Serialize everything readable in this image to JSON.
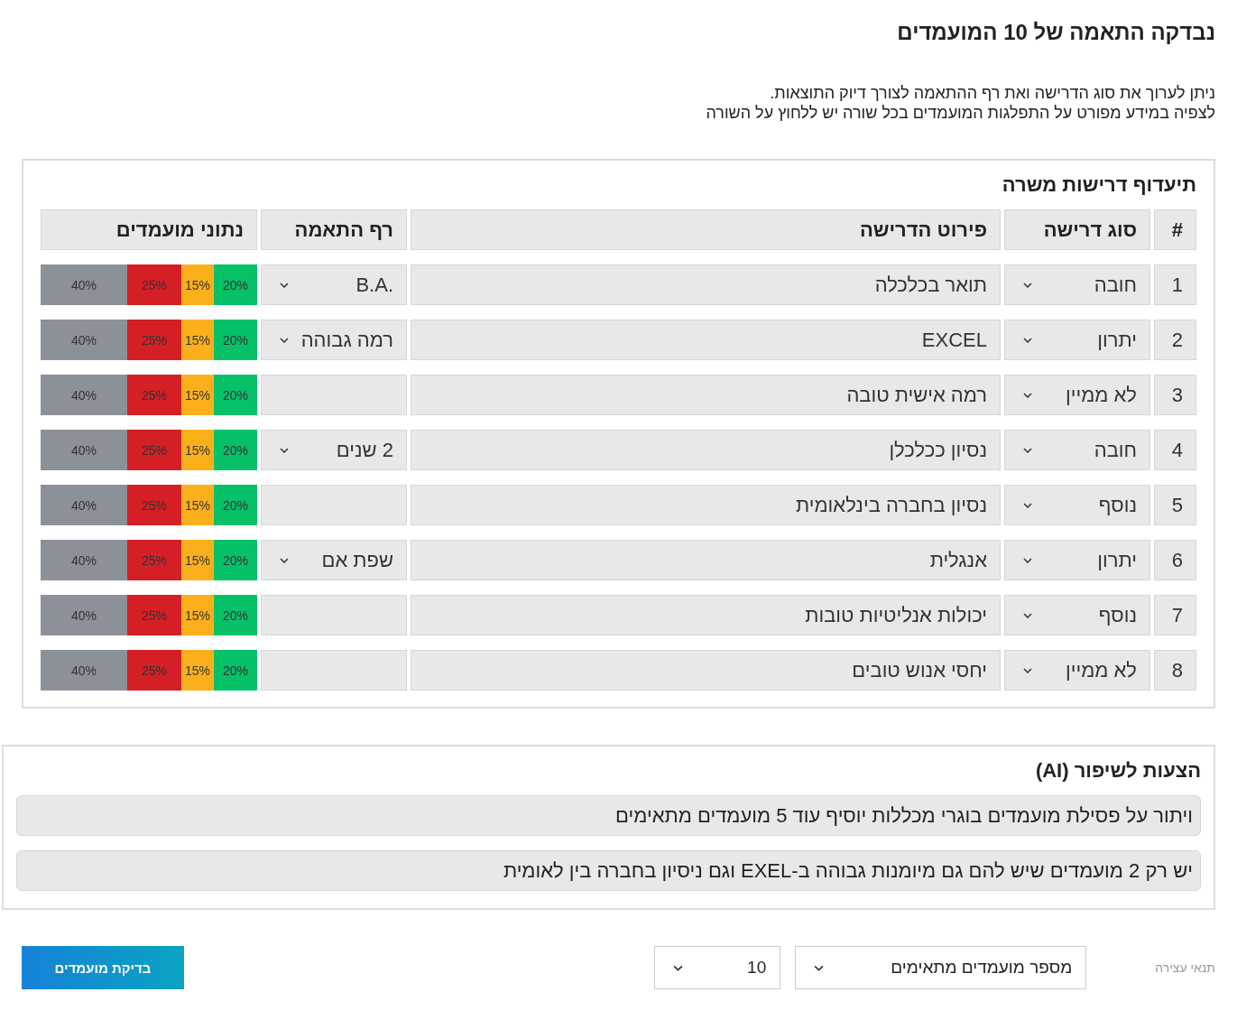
{
  "title": "נבדקה התאמה של 10 המועמדים",
  "intro": [
    "ניתן לערוך את סוג הדרישה ואת רף ההתאמה לצורך דיוק התוצאות.",
    "לצפיה במידע מפורט על התפלגות המועמדים בכל שורה יש ללחוץ על השורה"
  ],
  "requirements": {
    "title": "תיעדוף דרישות משרה",
    "columns": [
      "#",
      "סוג דרישה",
      "פירוט הדרישה",
      "רף התאמה",
      "נתוני מועמדים"
    ],
    "rows": [
      {
        "number": "1",
        "type": "חובה",
        "detail": "תואר בכלכלה",
        "threshold": "B.A.",
        "chart_data": {
          "type": "bar",
          "orientation": "horizontal",
          "stacked": true,
          "series": [
            {
              "color": "#8c9199",
              "values": [
                40
              ],
              "value_labels": [
                "40%"
              ]
            },
            {
              "color": "#d41f26",
              "values": [
                25
              ],
              "value_labels": [
                "25%"
              ]
            },
            {
              "color": "#fbb01b",
              "values": [
                15
              ],
              "value_labels": [
                "15%"
              ]
            },
            {
              "color": "#06c167",
              "values": [
                20
              ],
              "value_labels": [
                "20%"
              ]
            }
          ]
        }
      },
      {
        "number": "2",
        "type": "יתרון",
        "detail": "EXCEL",
        "threshold": "רמה גבוהה",
        "chart_data": {
          "type": "bar",
          "orientation": "horizontal",
          "stacked": true,
          "series": [
            {
              "color": "#8c9199",
              "values": [
                40
              ],
              "value_labels": [
                "40%"
              ]
            },
            {
              "color": "#d41f26",
              "values": [
                25
              ],
              "value_labels": [
                "25%"
              ]
            },
            {
              "color": "#fbb01b",
              "values": [
                15
              ],
              "value_labels": [
                "15%"
              ]
            },
            {
              "color": "#06c167",
              "values": [
                20
              ],
              "value_labels": [
                "20%"
              ]
            }
          ]
        }
      },
      {
        "number": "3",
        "type": "לא ממיין",
        "detail": "רמה אישית טובה",
        "chart_data": {
          "type": "bar",
          "orientation": "horizontal",
          "stacked": true,
          "series": [
            {
              "color": "#8c9199",
              "values": [
                40
              ],
              "value_labels": [
                "40%"
              ]
            },
            {
              "color": "#d41f26",
              "values": [
                25
              ],
              "value_labels": [
                "25%"
              ]
            },
            {
              "color": "#fbb01b",
              "values": [
                15
              ],
              "value_labels": [
                "15%"
              ]
            },
            {
              "color": "#06c167",
              "values": [
                20
              ],
              "value_labels": [
                "20%"
              ]
            }
          ]
        }
      },
      {
        "number": "4",
        "type": "חובה",
        "detail": "נסיון ככלכלן",
        "threshold": "2 שנים",
        "chart_data": {
          "type": "bar",
          "orientation": "horizontal",
          "stacked": true,
          "series": [
            {
              "color": "#8c9199",
              "values": [
                40
              ],
              "value_labels": [
                "40%"
              ]
            },
            {
              "color": "#d41f26",
              "values": [
                25
              ],
              "value_labels": [
                "25%"
              ]
            },
            {
              "color": "#fbb01b",
              "values": [
                15
              ],
              "value_labels": [
                "15%"
              ]
            },
            {
              "color": "#06c167",
              "values": [
                20
              ],
              "value_labels": [
                "20%"
              ]
            }
          ]
        }
      },
      {
        "number": "5",
        "type": "נוסף",
        "detail": "נסיון בחברה בינלאומית",
        "chart_data": {
          "type": "bar",
          "orientation": "horizontal",
          "stacked": true,
          "series": [
            {
              "color": "#8c9199",
              "values": [
                40
              ],
              "value_labels": [
                "40%"
              ]
            },
            {
              "color": "#d41f26",
              "values": [
                25
              ],
              "value_labels": [
                "25%"
              ]
            },
            {
              "color": "#fbb01b",
              "values": [
                15
              ],
              "value_labels": [
                "15%"
              ]
            },
            {
              "color": "#06c167",
              "values": [
                20
              ],
              "value_labels": [
                "20%"
              ]
            }
          ]
        }
      },
      {
        "number": "6",
        "type": "יתרון",
        "detail": "אנגלית",
        "threshold": "שפת אם",
        "chart_data": {
          "type": "bar",
          "orientation": "horizontal",
          "stacked": true,
          "series": [
            {
              "color": "#8c9199",
              "values": [
                40
              ],
              "value_labels": [
                "40%"
              ]
            },
            {
              "color": "#d41f26",
              "values": [
                25
              ],
              "value_labels": [
                "25%"
              ]
            },
            {
              "color": "#fbb01b",
              "values": [
                15
              ],
              "value_labels": [
                "15%"
              ]
            },
            {
              "color": "#06c167",
              "values": [
                20
              ],
              "value_labels": [
                "20%"
              ]
            }
          ]
        }
      },
      {
        "number": "7",
        "type": "נוסף",
        "detail": "יכולות אנליטיות טובות",
        "chart_data": {
          "type": "bar",
          "orientation": "horizontal",
          "stacked": true,
          "series": [
            {
              "color": "#8c9199",
              "values": [
                40
              ],
              "value_labels": [
                "40%"
              ]
            },
            {
              "color": "#d41f26",
              "values": [
                25
              ],
              "value_labels": [
                "25%"
              ]
            },
            {
              "color": "#fbb01b",
              "values": [
                15
              ],
              "value_labels": [
                "15%"
              ]
            },
            {
              "color": "#06c167",
              "values": [
                20
              ],
              "value_labels": [
                "20%"
              ]
            }
          ]
        }
      },
      {
        "number": "8",
        "type": "לא ממיין",
        "detail": "יחסי אנוש טובים",
        "chart_data": {
          "type": "bar",
          "orientation": "horizontal",
          "stacked": true,
          "series": [
            {
              "color": "#8c9199",
              "values": [
                40
              ],
              "value_labels": [
                "40%"
              ]
            },
            {
              "color": "#d41f26",
              "values": [
                25
              ],
              "value_labels": [
                "25%"
              ]
            },
            {
              "color": "#fbb01b",
              "values": [
                15
              ],
              "value_labels": [
                "15%"
              ]
            },
            {
              "color": "#06c167",
              "values": [
                20
              ],
              "value_labels": [
                "20%"
              ]
            }
          ]
        }
      }
    ]
  },
  "suggestions": {
    "title": "הצעות לשיפור (AI)",
    "items": [
      "ויתור על פסילת מועמדים בוגרי מכללות יוסיף עוד 5 מועמדים מתאימים",
      "יש רק 2 מועמדים שיש להם גם מיומנות גבוהה ב-EXEL וגם ניסיון בחברה בין לאומית"
    ]
  },
  "footer": {
    "stop_label": "תנאי עצירה",
    "stop_condition": "מספר מועמדים מתאימים",
    "stop_value": "10",
    "button": "בדיקת מועמדים"
  }
}
